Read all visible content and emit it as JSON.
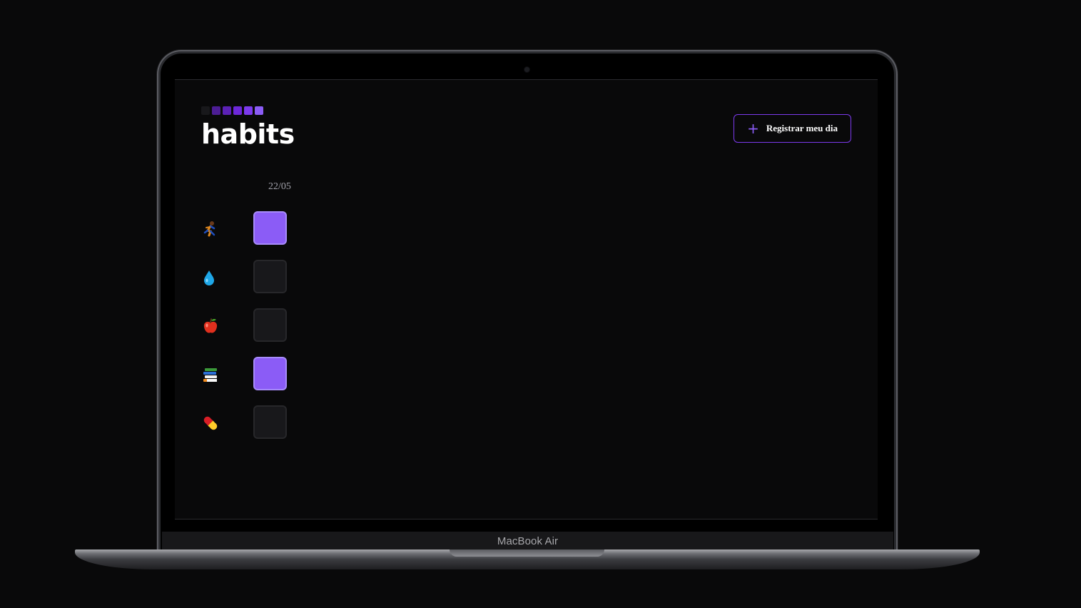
{
  "device": {
    "label": "MacBook Air"
  },
  "app": {
    "logo": {
      "text": "habits",
      "squares": [
        "#18181b",
        "#4c1d95",
        "#5b21b6",
        "#6d28d9",
        "#7c3aed",
        "#8b5cf6"
      ]
    },
    "register_button": {
      "label": "Registrar meu dia",
      "icon": "plus-icon"
    }
  },
  "summary": {
    "dates": [
      "22/05"
    ],
    "habits": [
      {
        "icon": "runner-icon",
        "completed": true
      },
      {
        "icon": "droplet-icon",
        "completed": false
      },
      {
        "icon": "apple-icon",
        "completed": false
      },
      {
        "icon": "books-icon",
        "completed": true
      },
      {
        "icon": "pill-icon",
        "completed": false
      }
    ]
  },
  "colors": {
    "accent": "#8b5cf6",
    "accent_border": "#7c3aed",
    "background": "#09090a",
    "cell_empty": "#18181b"
  }
}
